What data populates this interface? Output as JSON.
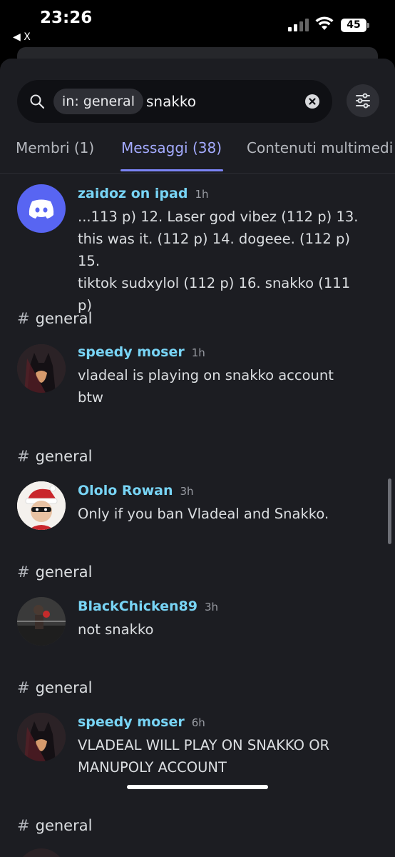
{
  "status_bar": {
    "time": "23:26",
    "back_label": "◀ X",
    "battery": "45"
  },
  "search": {
    "filter_chip": "in: general",
    "query": "snakko"
  },
  "tabs": [
    {
      "label": "Membri  (1)"
    },
    {
      "label": "Messaggi  (38)"
    },
    {
      "label": "Contenuti multimedi"
    }
  ],
  "messages": [
    {
      "author": "zaidoz on ipad",
      "time": "1h",
      "lines": [
        "...113 p) 12. Laser god vibez  (112 p) 13.",
        "this was it.  (112 p) 14. dogeee. (112 p) 15.",
        "tiktok sudxylol (112 p) 16. snakko (111 p)"
      ]
    },
    {
      "channel": "general",
      "author": "speedy moser",
      "time": "1h",
      "lines": [
        "vladeal is playing on snakko account",
        "btw"
      ]
    },
    {
      "channel": "general",
      "author": "Ololo Rowan",
      "time": "3h",
      "lines": [
        "Only if you ban Vladeal and Snakko."
      ]
    },
    {
      "channel": "general",
      "author": "BlackChicken89",
      "time": "3h",
      "lines": [
        "not snakko"
      ]
    },
    {
      "channel": "general",
      "author": "speedy moser",
      "time": "6h",
      "lines": [
        "VLADEAL WILL PLAY ON SNAKKO OR",
        "MANUPOLY ACCOUNT"
      ]
    },
    {
      "channel": "general"
    }
  ]
}
